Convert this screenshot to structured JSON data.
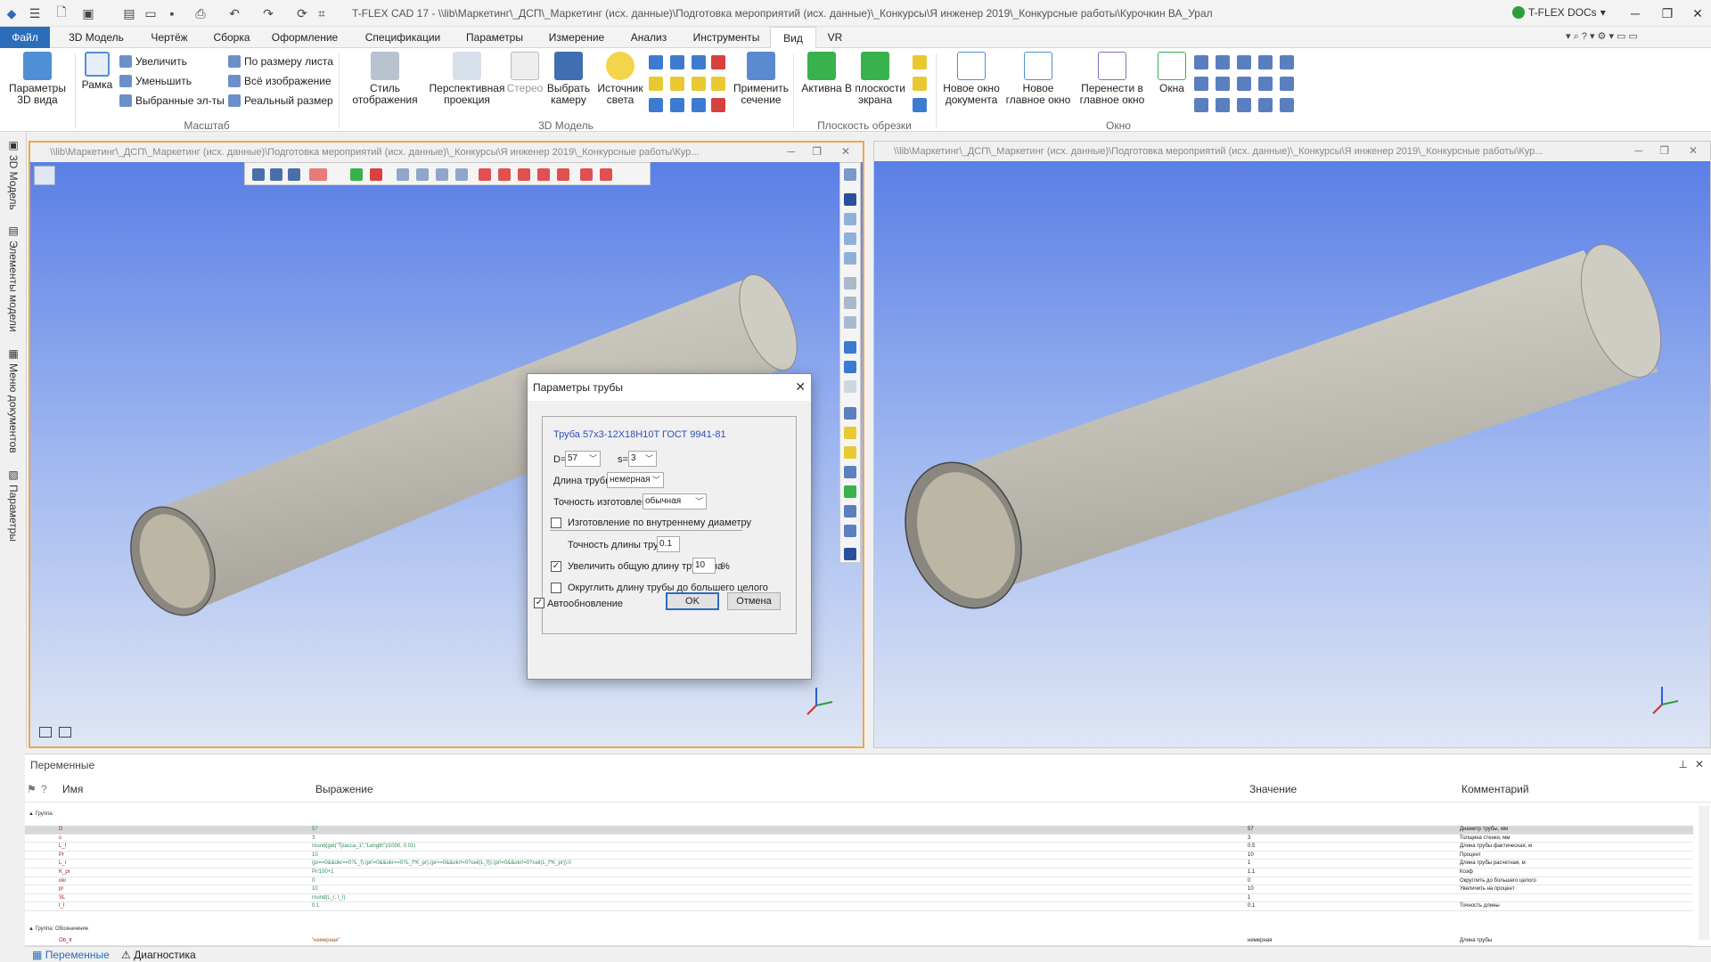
{
  "titlebar": {
    "title": "T-FLEX CAD 17 - \\\\lib\\Маркетинг\\_ДСП\\_Маркетинг (исх. данные)\\Подготовка мероприятий (исх. данные)\\_Конкурсы\\Я инженер 2019\\_Конкурсные работы\\Курочкин ВА_Урал",
    "docs_label": "T-FLEX DOCs",
    "help_icon": "question-icon",
    "settings_icon": "gear-icon"
  },
  "tabs": [
    {
      "label": "Файл"
    },
    {
      "label": "3D Модель"
    },
    {
      "label": "Чертёж"
    },
    {
      "label": "Сборка"
    },
    {
      "label": "Оформление"
    },
    {
      "label": "Спецификации"
    },
    {
      "label": "Параметры"
    },
    {
      "label": "Измерение"
    },
    {
      "label": "Анализ"
    },
    {
      "label": "Инструменты"
    },
    {
      "label": "Вид"
    },
    {
      "label": "VR"
    }
  ],
  "ribbon": {
    "params3d": "Параметры\n3D вида",
    "frame": "Рамка",
    "zoom_in": "Увеличить",
    "zoom_out": "Уменьшить",
    "selected": "Выбранные эл-ты",
    "fit_sheet": "По размеру листа",
    "whole_image": "Всё изображение",
    "real_size": "Реальный размер",
    "group_scale": "Масштаб",
    "display_style": "Стиль\nотображения",
    "perspective": "Перспективная\nпроекция",
    "stereo": "Стерео",
    "select_camera": "Выбрать\nкамеру",
    "light_source": "Источник\nсвета",
    "apply_section": "Применить\nсечение",
    "group_3d": "3D Модель",
    "active": "Активна",
    "in_screen_plane": "В плоскости\nэкрана",
    "group_clip": "Плоскость обрезки",
    "new_doc_window": "Новое окно\nдокумента",
    "new_main_window": "Новое\nглавное окно",
    "move_to_main": "Перенести в\nглавное окно",
    "windows": "Окна",
    "group_window": "Окно"
  },
  "sidepanel": {
    "tab1": "3D Модель",
    "tab2": "Элементы модели",
    "tab3": "Меню документов",
    "tab4": "Параметры"
  },
  "docwin": {
    "left_title": "\\\\lib\\Маркетинг\\_ДСП\\_Маркетинг (исх. данные)\\Подготовка мероприятий (исх. данные)\\_Конкурсы\\Я инженер 2019\\_Конкурсные работы\\Кур...",
    "right_title": "\\\\lib\\Маркетинг\\_ДСП\\_Маркетинг (исх. данные)\\Подготовка мероприятий (исх. данные)\\_Конкурсы\\Я инженер 2019\\_Конкурсные работы\\Кур..."
  },
  "dialog": {
    "title": "Параметры трубы",
    "pipe_name": "Труба 57x3-12X18H10T ГОСТ 9941-81",
    "d_label": "D=",
    "d_value": "57",
    "s_label": "s=",
    "s_value": "3",
    "length_label": "Длина трубы",
    "length_value": "немерная",
    "accuracy_label": "Точность изготовления",
    "accuracy_value": "обычная",
    "inner_diam_label": "Изготовление по внутреннему диаметру",
    "length_accuracy_label": "Точность длины трубы",
    "length_accuracy_value": "0.1",
    "increase_label": "Увеличить общую длину трубы на",
    "increase_value": "10",
    "percent": "%",
    "round_label": "Округлить длину трубы до большего целого",
    "autoupdate_label": "Автообновление",
    "ok": "OK",
    "cancel": "Отмена"
  },
  "variables": {
    "header": "Переменные",
    "col_name": "Имя",
    "col_expr": "Выражение",
    "col_value": "Значение",
    "col_comment": "Комментарий",
    "group1": "Группа:",
    "group2": "Группа: Обозначение",
    "rows": [
      {
        "name": "D",
        "expr": "57",
        "value": "57",
        "comment": "Диаметр трубы, мм"
      },
      {
        "name": "s",
        "expr": "3",
        "value": "3",
        "comment": "Толщина стенки, мм"
      },
      {
        "name": "L_f",
        "expr": "round(get(\"Трасса_1\",\"Length\")/1000, 0.01)",
        "value": "0.5",
        "comment": "Длина трубы фактическая, м"
      },
      {
        "name": "Pr",
        "expr": "10",
        "value": "10",
        "comment": "Процент"
      },
      {
        "name": "L_r",
        "expr": "(pr==0&&okr==0?L_f):(pr!=0&&okr==0?L_f*K_pr):(pr==0&&okr!=0?ceil(L_f)):(pr!=0&&okr!=0?ceil(L_f*K_pr)):0",
        "value": "1",
        "comment": "Длина трубы расчетная, м"
      },
      {
        "name": "K_pr",
        "expr": "Pr/100+1",
        "value": "1.1",
        "comment": "Коэф"
      },
      {
        "name": "okr",
        "expr": "0",
        "value": "0",
        "comment": "Округлить до большего целого"
      },
      {
        "name": "pr",
        "expr": "10",
        "value": "10",
        "comment": "Увеличить на процент"
      },
      {
        "name": "SL",
        "expr": "round(L_r, t_l)",
        "value": "1",
        "comment": ""
      },
      {
        "name": "t_l",
        "expr": "0.1",
        "value": "0.1",
        "comment": "Точность длины"
      }
    ],
    "row_last": {
      "name": "Ob_tr",
      "expr": "\"немерная\"",
      "value": "немерная",
      "comment": "Длина трубы"
    }
  },
  "bottom_tabs": {
    "variables": "Переменные",
    "diagnostics": "Диагностика"
  }
}
